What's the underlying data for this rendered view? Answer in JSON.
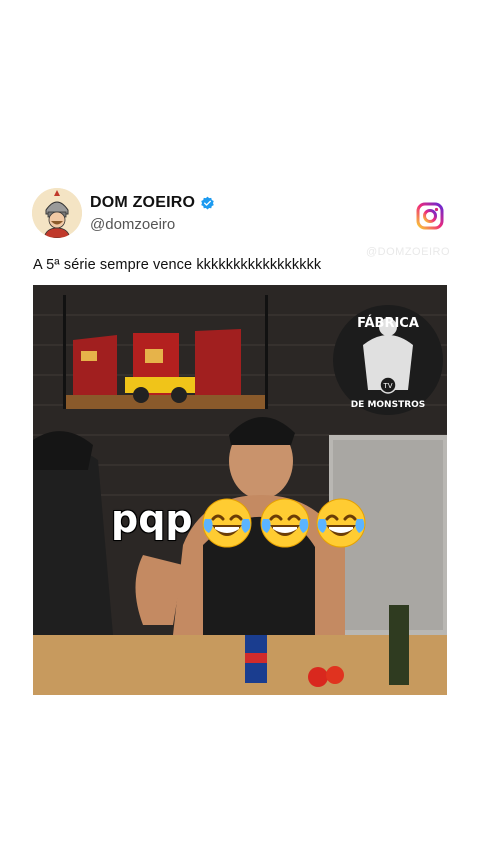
{
  "post": {
    "display_name": "DOM ZOEIRO",
    "handle": "@domzoeiro",
    "caption": "A 5ª série sempre vence kkkkkkkkkkkkkkkkk",
    "watermark": "@DOMZOEIRO"
  },
  "video": {
    "overlay_text": "pqp",
    "logo_top": "FÁBRICA",
    "logo_mid": "TV",
    "logo_bottom": "DE MONSTROS"
  },
  "icons": {
    "verified": "verified-badge-icon",
    "instagram": "instagram-icon",
    "emoji": "laughing-crying-emoji"
  },
  "colors": {
    "verified_blue": "#1d9bf0",
    "instagram_gradient": [
      "#f9ce34",
      "#ee2a7b",
      "#6228d7"
    ]
  }
}
